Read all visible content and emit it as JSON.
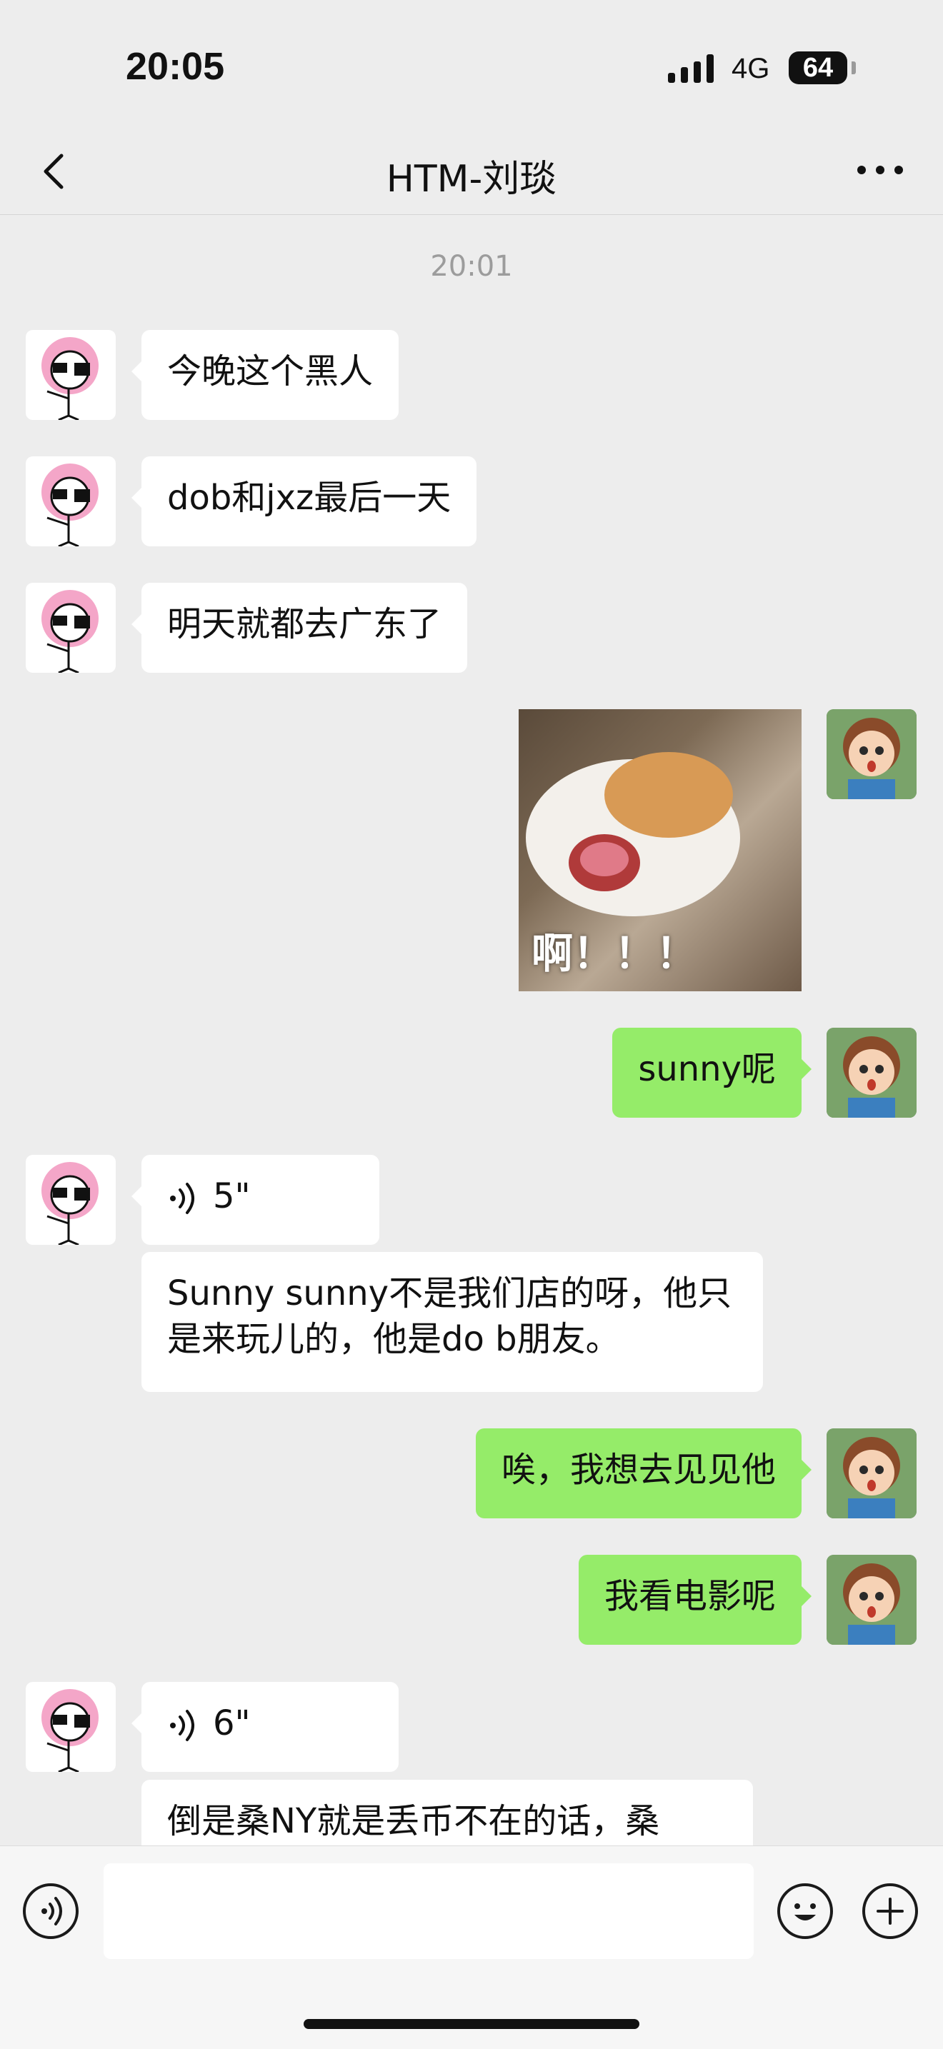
{
  "status_bar": {
    "time": "20:05",
    "network": "4G",
    "battery": "64"
  },
  "nav": {
    "title": "HTM-刘琰",
    "back_icon": "chevron-left-icon",
    "more_icon": "ellipsis-icon"
  },
  "messages": {
    "timestamp": "20:01",
    "m1": "今晚这个黑人",
    "m2": "dob和jxz最后一天",
    "m3": "明天就都去广东了",
    "m4_sticker_caption": "啊！！！",
    "m5": "sunny呢",
    "m6_voice": "5\"",
    "m7_transcript": "Sunny sunny不是我们店的呀，他只是来玩儿的，他是do b朋友。",
    "m8": "唉，我想去见见他",
    "m9": "我看电影呢",
    "m10_voice": "6\"",
    "m11_transcript": "倒是桑NY就是丢币不在的话，桑"
  },
  "input_bar": {
    "placeholder": "",
    "voice_icon": "voice-icon",
    "emoji_icon": "emoji-icon",
    "plus_icon": "plus-icon"
  },
  "colors": {
    "background": "#ededed",
    "sent_bubble": "#95ec69",
    "received_bubble": "#ffffff"
  }
}
